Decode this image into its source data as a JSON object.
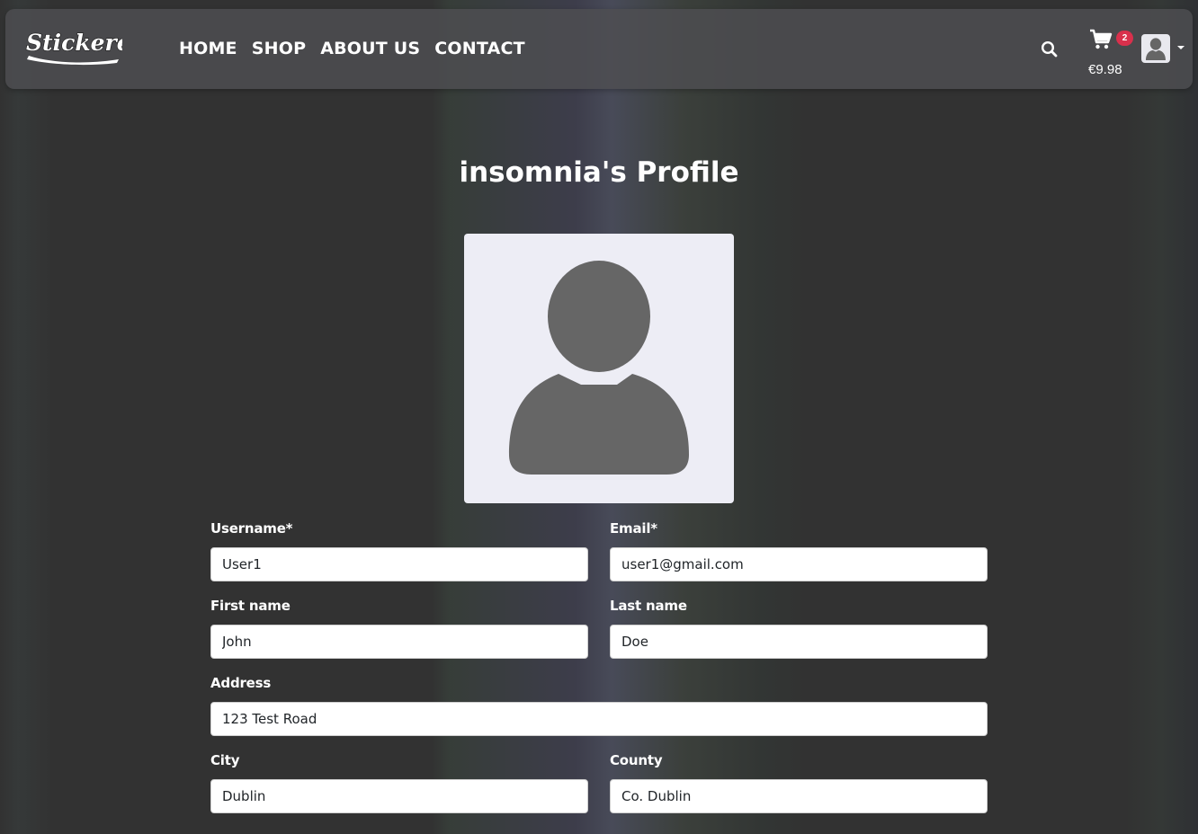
{
  "nav": {
    "brand": "Stickered",
    "links": [
      "HOME",
      "SHOP",
      "ABOUT US",
      "CONTACT"
    ],
    "cart_count": "2",
    "cart_total": "€9.98",
    "icons": {
      "search": "search-icon",
      "cart": "cart-icon",
      "user": "user-icon",
      "caret": "chevron-down-icon"
    }
  },
  "profile": {
    "title": "insomnia's Profile"
  },
  "form": {
    "username": {
      "label": "Username*",
      "value": "User1"
    },
    "email": {
      "label": "Email*",
      "value": "user1@gmail.com"
    },
    "first_name": {
      "label": "First name",
      "value": "John"
    },
    "last_name": {
      "label": "Last name",
      "value": "Doe"
    },
    "address": {
      "label": "Address",
      "value": "123 Test Road"
    },
    "city": {
      "label": "City",
      "value": "Dublin"
    },
    "county": {
      "label": "County",
      "value": "Co. Dublin"
    }
  },
  "colors": {
    "background": "#323232",
    "navbar": "#4e4e52",
    "badge": "#d9304c",
    "avatar_bg": "#ededf5",
    "avatar_fg": "#666666"
  }
}
